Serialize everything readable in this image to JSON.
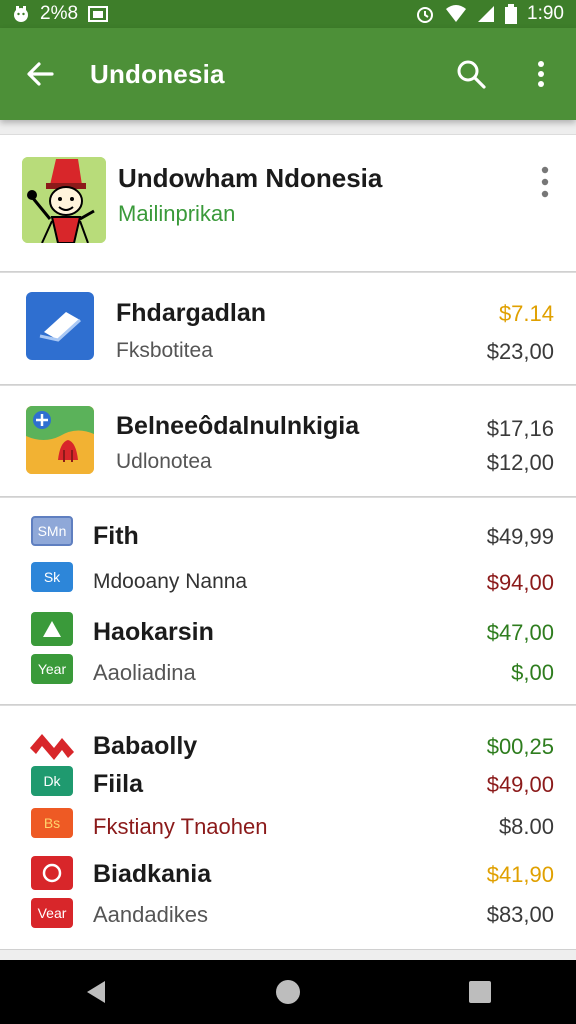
{
  "status": {
    "left_text": "2%8",
    "time": "1:90"
  },
  "header": {
    "title": "Undonesia"
  },
  "featured": {
    "title": "Undowham Ndonesia",
    "subtitle": "Mailinprikan",
    "colors": {
      "subtitle": "#3a9a3a"
    }
  },
  "items": [
    {
      "name": "Fhdargadlan",
      "sub": "Fksbotitea",
      "price1": "$7.14",
      "price2": "$23,00"
    },
    {
      "name": "Belneeôdalnulnkigia",
      "sub": "Udlonotea",
      "price1": "$17,16",
      "price2": "$12,00"
    }
  ],
  "list1": [
    {
      "icon_text": "SMn",
      "name": "Fith",
      "price": "$49,99"
    },
    {
      "icon_text": "Sk",
      "name": "Mdooany Nanna",
      "price": "$94,00"
    },
    {
      "icon_text": "",
      "name": "Haokarsin",
      "price": "$47,00"
    },
    {
      "icon_text": "Year",
      "name": "Aaoliadina",
      "price": "$,00"
    }
  ],
  "list2": [
    {
      "icon_text": "",
      "name": "Babaolly",
      "price": "$00,25"
    },
    {
      "icon_text": "Dk",
      "name": "Fiila",
      "price": "$49,00"
    },
    {
      "icon_text": "Bs",
      "name": "Fkstiany Tnaohen",
      "price": "$8.00"
    },
    {
      "icon_text": "",
      "name": "Biadkania",
      "price": "$41,90"
    },
    {
      "icon_text": "Vear",
      "name": "Aandadikes",
      "price": "$83,00"
    }
  ],
  "colors": {
    "appbar": "#4d9038",
    "statusbar": "#3e7e2a",
    "price_orange": "#e0a000",
    "price_green": "#2e7d1e",
    "price_red": "#8b1a1a",
    "price_gray": "#3a3a3a"
  }
}
